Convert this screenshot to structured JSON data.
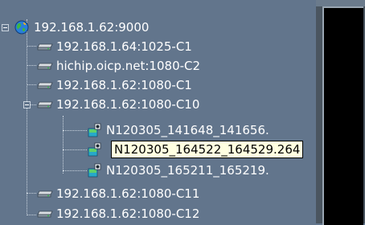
{
  "tree": {
    "root": {
      "label": "192.168.1.62:9000",
      "icon": "globe-icon"
    },
    "nodes": [
      {
        "label": "192.168.1.64:1025-C1",
        "icon": "device-icon"
      },
      {
        "label": "hichip.oicp.net:1080-C2",
        "icon": "device-icon"
      },
      {
        "label": "192.168.1.62:1080-C1",
        "icon": "device-icon"
      },
      {
        "label": "192.168.1.62:1080-C10",
        "icon": "device-icon",
        "expanded": true,
        "children": [
          {
            "label": "N120305_141648_141656.",
            "icon": "camera-file-icon"
          },
          {
            "label": "N120305_164522_164529.264",
            "icon": "camera-file-icon",
            "hovered": true
          },
          {
            "label": "N120305_165211_165219.",
            "icon": "camera-file-icon"
          }
        ]
      },
      {
        "label": "192.168.1.62:1080-C11",
        "icon": "device-icon"
      },
      {
        "label": "192.168.1.62:1080-C12",
        "icon": "device-icon"
      }
    ]
  },
  "colors": {
    "background": "#62758c",
    "text": "#ffffff",
    "tooltip_bg": "#ffffe1",
    "right_panel": "#000000"
  }
}
